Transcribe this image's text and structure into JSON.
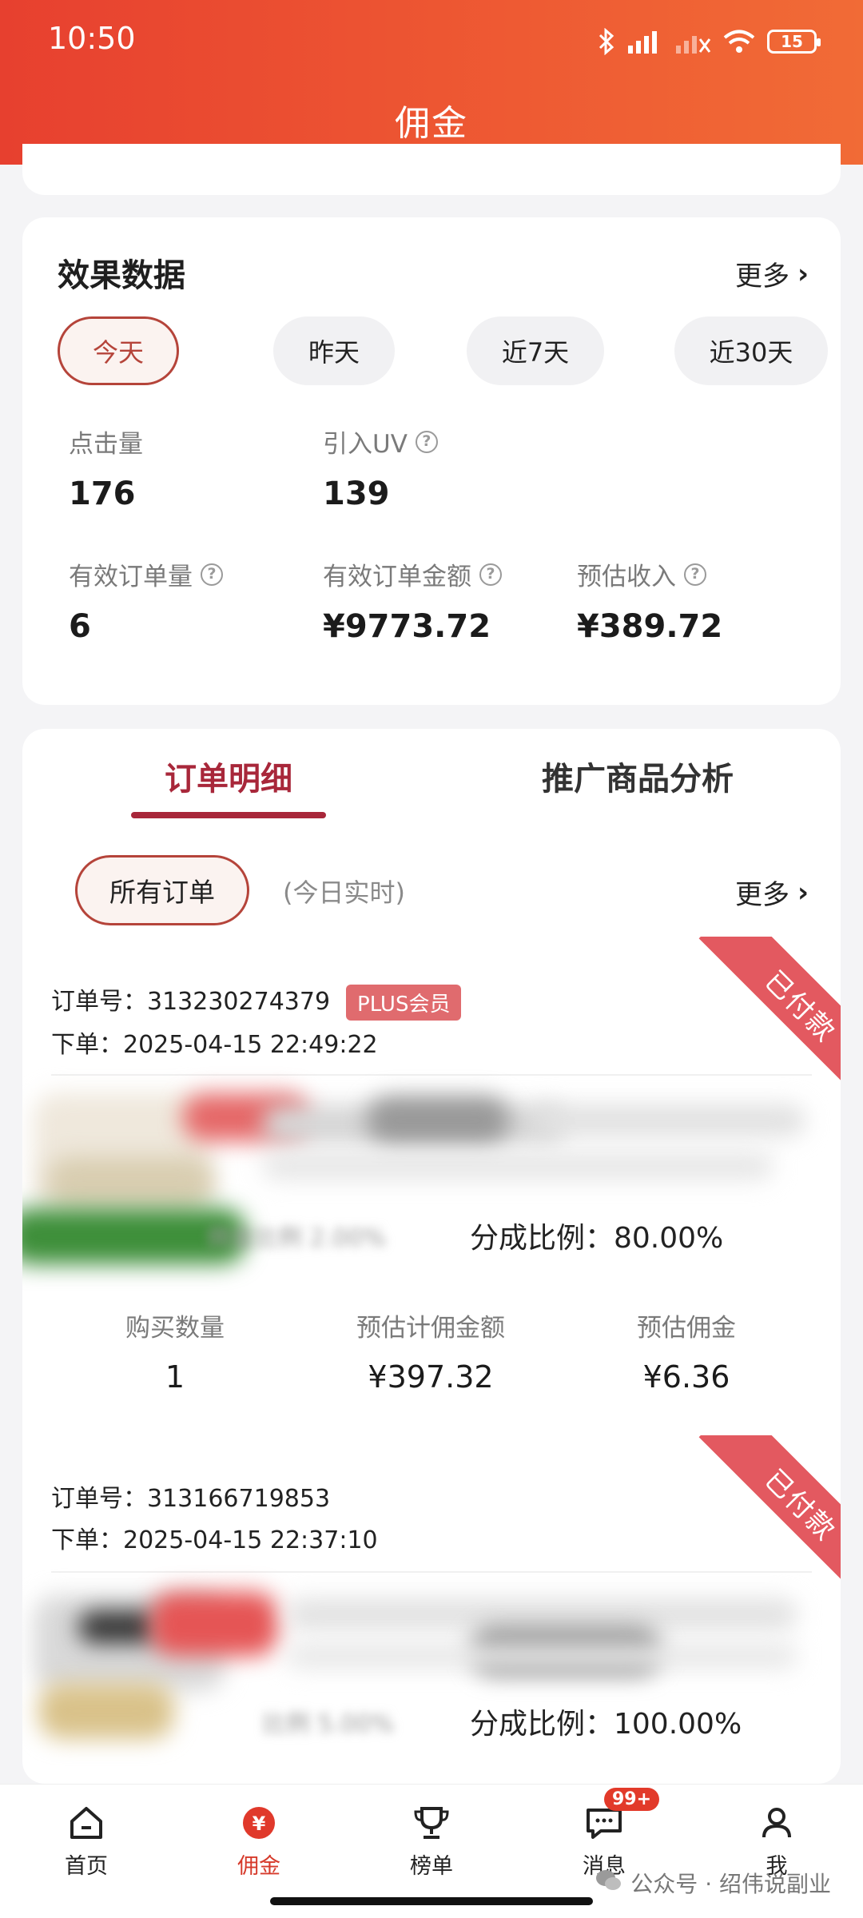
{
  "status_bar": {
    "time": "10:50",
    "battery": "15"
  },
  "header": {
    "title": "佣金"
  },
  "effect": {
    "title": "效果数据",
    "more": "更多",
    "ranges": [
      "今天",
      "昨天",
      "近7天",
      "近30天"
    ],
    "active_range": "今天",
    "metrics": {
      "clicks": {
        "label": "点击量",
        "value": "176"
      },
      "uv": {
        "label": "引入UV",
        "value": "139"
      },
      "orders": {
        "label": "有效订单量",
        "value": "6"
      },
      "amount": {
        "label": "有效订单金额",
        "value": "¥9773.72"
      },
      "income": {
        "label": "预估收入",
        "value": "¥389.72"
      }
    }
  },
  "order_panel": {
    "tabs": [
      "订单明细",
      "推广商品分析"
    ],
    "filter": "所有订单",
    "filter_sub": "(今日实时)",
    "more": "更多",
    "orders": [
      {
        "number": "订单号：313230274379",
        "badge": "PLUS会员",
        "time": "下单：2025-04-15 22:49:22",
        "status": "已付款",
        "commission_ratio": "佣金比例 2.00%",
        "split_ratio": "分成比例：80.00%",
        "stats": [
          {
            "label": "购买数量",
            "value": "1"
          },
          {
            "label": "预估计佣金额",
            "value": "¥397.32"
          },
          {
            "label": "预估佣金",
            "value": "¥6.36"
          }
        ]
      },
      {
        "number": "订单号：313166719853",
        "time": "下单：2025-04-15 22:37:10",
        "status": "已付款",
        "commission_ratio": "比例 5.00%",
        "split_ratio": "分成比例：100.00%"
      }
    ]
  },
  "bottom_nav": {
    "items": [
      "首页",
      "佣金",
      "榜单",
      "消息",
      "我"
    ],
    "message_badge": "99+"
  },
  "watermark": "公众号 · 绍伟说副业"
}
